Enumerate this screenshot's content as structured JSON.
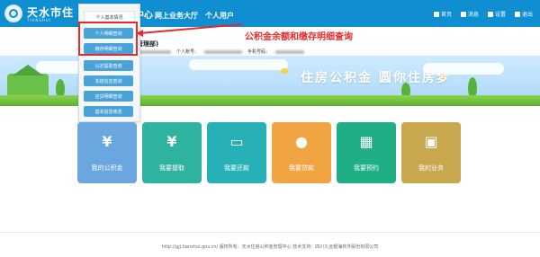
{
  "header": {
    "brand_title": "天水市住",
    "brand_sub": "TIANSHUI",
    "center_text": "中心",
    "nav": [
      "网上业务大厅",
      "个人用户"
    ],
    "right_nav": [
      {
        "label": "首页",
        "icon": "home-icon"
      },
      {
        "label": "消息",
        "icon": "message-icon"
      },
      {
        "label": "设置",
        "icon": "settings-icon"
      },
      {
        "label": "退出",
        "icon": "logout-icon"
      }
    ]
  },
  "menu": {
    "top_item": "个人基本情况",
    "items": [
      "个人明细查询",
      "缴存明细查询",
      "认定提取查询",
      "冻结信息查询",
      "还贷明细查询",
      "基本信息修改"
    ]
  },
  "annotation": {
    "text": "公积金余额和缴存明细查询",
    "color": "#e32b2b"
  },
  "info": {
    "admin_label": "管理部)",
    "account_label": "个人账号：",
    "phone_label": "手机号码："
  },
  "banner": {
    "slogan": "住房公积金  圆你住房梦"
  },
  "tiles": [
    {
      "label": "我的公积金",
      "icon": "yen-icon",
      "color": "#6aa6e0"
    },
    {
      "label": "我要提取",
      "icon": "withdraw-icon",
      "color": "#2fb3a0"
    },
    {
      "label": "我要还款",
      "icon": "card-icon",
      "color": "#27b1b7"
    },
    {
      "label": "我要贷款",
      "icon": "money-bag-icon",
      "color": "#f1a542"
    },
    {
      "label": "我要预约",
      "icon": "calendar-icon",
      "color": "#1fae86"
    },
    {
      "label": "我的业务",
      "icon": "briefcase-icon",
      "color": "#c9a74e"
    }
  ],
  "footer": {
    "text": "http://gjj.tianshui.gov.cn/ 版权所有：天水住房公积金管理中心 技术支持：四川久远银海软件股份有限公司"
  }
}
